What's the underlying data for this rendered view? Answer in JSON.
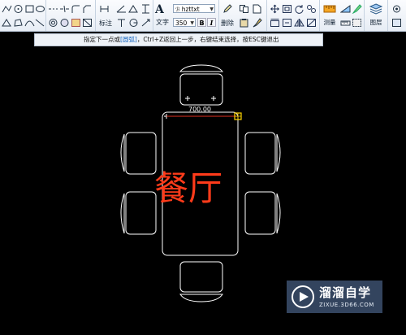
{
  "toolbar": {
    "text_group": {
      "text_label": "文字",
      "font_name": "hzttxt",
      "text_height": "350",
      "bold_label": "B",
      "italic_label": "I"
    },
    "dim_label": "标注",
    "erase_label": "删除",
    "measure_label": "测量",
    "layer_label": "图层"
  },
  "command_prompt": {
    "text_before": "指定下一点或",
    "highlight": "[圆弧]",
    "text_after": "，Ctrl+Z返回上一步，右键结束选择，按ESC键退出"
  },
  "drawing": {
    "dimension_value": "700.00",
    "room_label": "餐厅",
    "colors": {
      "background": "#000000",
      "lines": "#ffffff",
      "room_label": "#ff3b1a",
      "dimension_line": "#e03020",
      "grip": "#ffd400"
    }
  },
  "watermark": {
    "name": "溜溜自学",
    "url": "ZIXUE.3D66.COM"
  }
}
